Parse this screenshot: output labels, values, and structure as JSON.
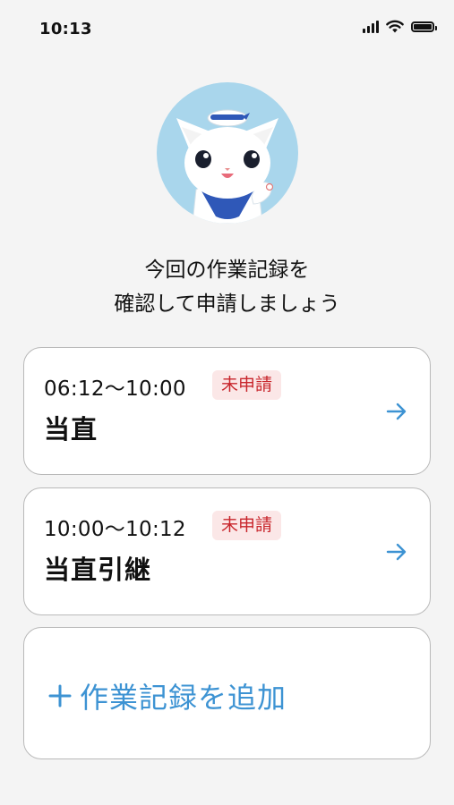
{
  "status_bar": {
    "time": "10:13",
    "icons": [
      "cellular-signal-icon",
      "wifi-icon",
      "battery-icon"
    ]
  },
  "mascot": {
    "icon": "cat-mascot-avatar",
    "background_color": "#a9d6ec"
  },
  "headline": {
    "line1": "今回の作業記録を",
    "line2": "確認して申請しましょう"
  },
  "records": [
    {
      "time_range": "06:12〜10:00",
      "status": "未申請",
      "title": "当直",
      "icon": "arrow-right-icon"
    },
    {
      "time_range": "10:00〜10:12",
      "status": "未申請",
      "title": "当直引継",
      "icon": "arrow-right-icon"
    }
  ],
  "add_record": {
    "icon": "plus-icon",
    "label": "作業記録を追加"
  },
  "colors": {
    "accent": "#3d93d3",
    "badge_text": "#c8262c",
    "badge_bg": "#fbe7e7",
    "background": "#f4f4f4",
    "card_border": "#b9b9b9"
  }
}
